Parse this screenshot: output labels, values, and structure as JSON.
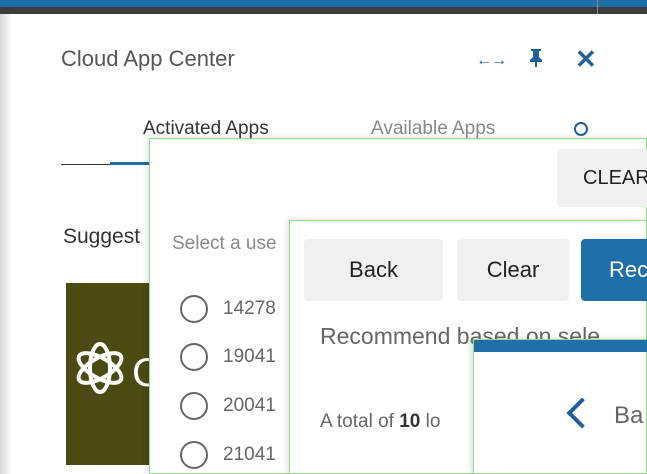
{
  "panel": {
    "title": "Cloud App Center",
    "tabs": [
      {
        "label": "Activated Apps",
        "active": true
      },
      {
        "label": "Available Apps",
        "active": false
      }
    ],
    "suggested_label": "Suggest",
    "app_tile_letter": "C",
    "accent_color": "#1f6fa8"
  },
  "dialog_select": {
    "clear_label": "CLEAR",
    "select_placeholder": "Select a use",
    "options": [
      "14278",
      "19041",
      "20041",
      "21041"
    ]
  },
  "dialog_recommend": {
    "back_label": "Back",
    "clear_label": "Clear",
    "recommend_label": "Rec",
    "heading": "Recommend based on sele",
    "total_prefix": "A total of ",
    "total_count": "10",
    "total_suffix": " lo"
  },
  "dialog_nested": {
    "back_label": "Ba"
  }
}
